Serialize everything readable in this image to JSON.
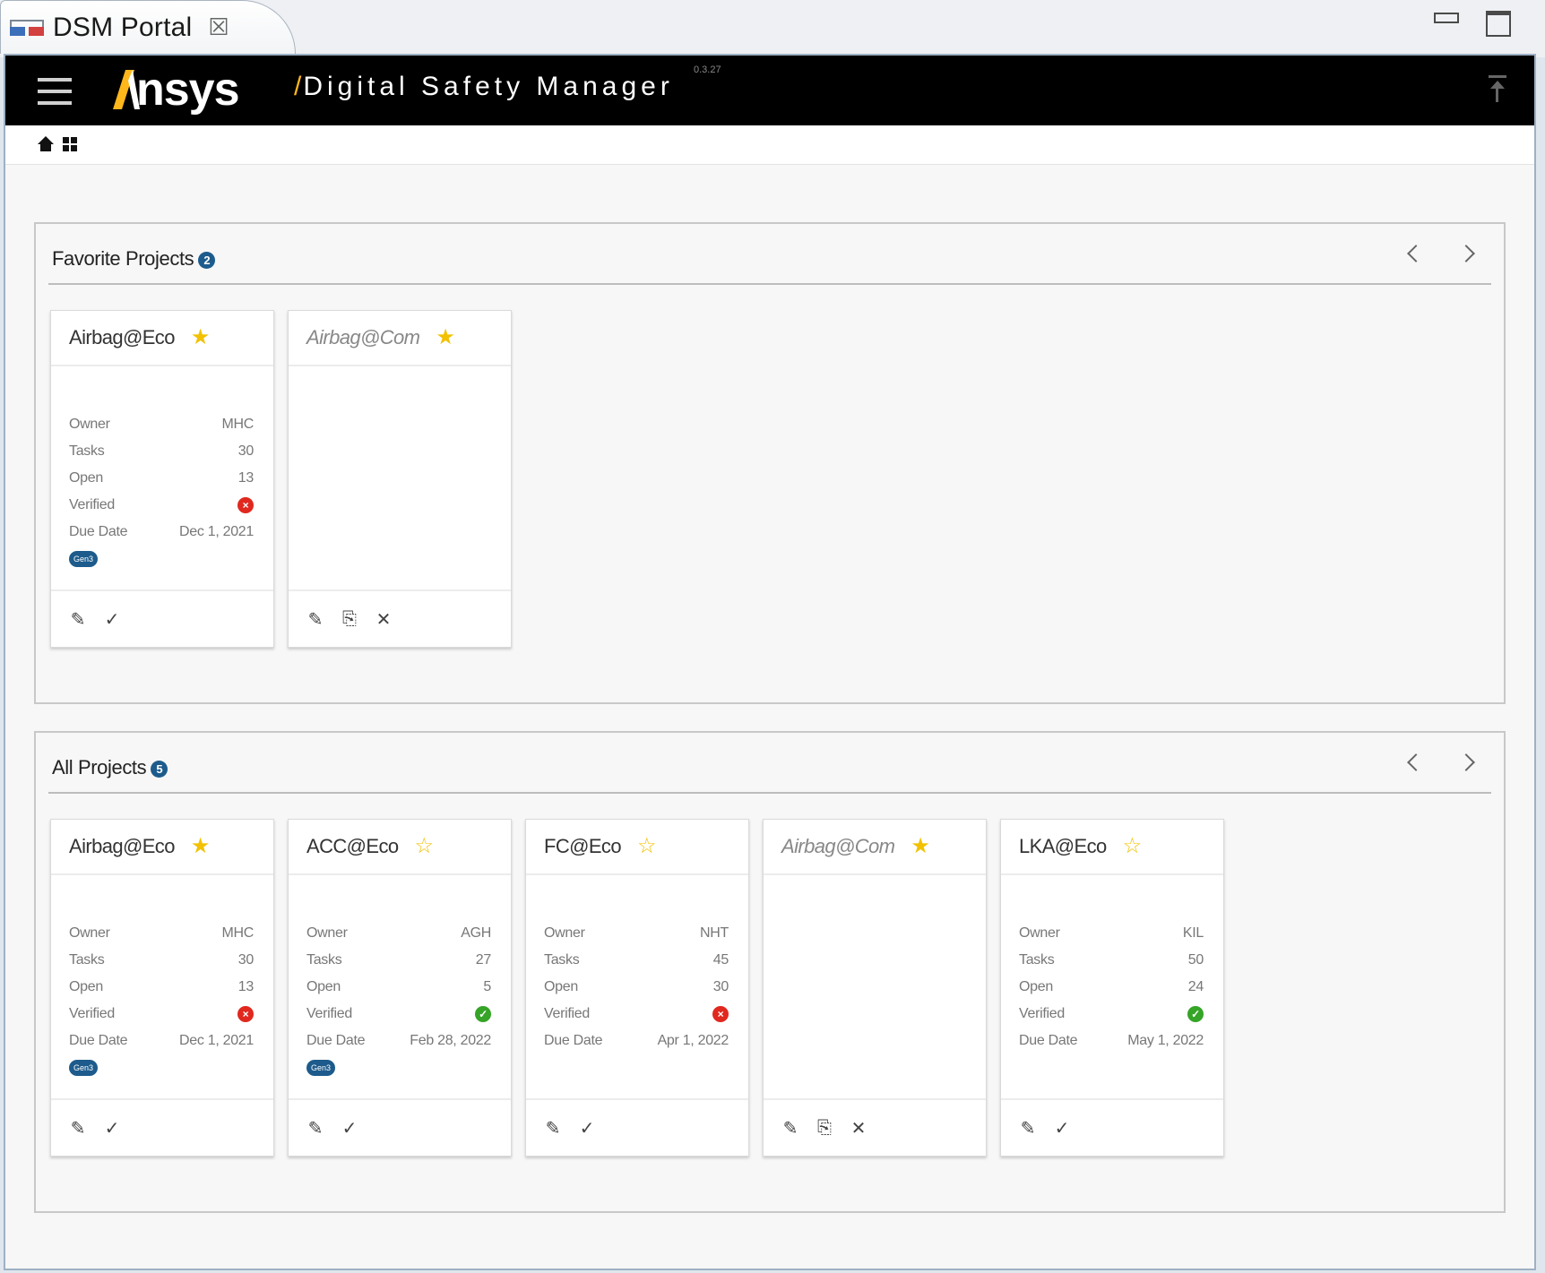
{
  "view_tab": {
    "title": "DSM Portal",
    "close_glyph": "☒"
  },
  "topbar": {
    "logo_text": "nsys",
    "product_slash": "/",
    "product_name": "Digital Safety Manager",
    "version": "0.3.27",
    "colors": {
      "background": "#000000",
      "accent": "#ffb71b"
    }
  },
  "breadcrumb": {
    "home_icon": "home-icon",
    "apps_icon": "apps-grid-icon"
  },
  "labels": {
    "owner": "Owner",
    "tasks": "Tasks",
    "open": "Open",
    "verified": "Verified",
    "due_date": "Due Date"
  },
  "icons": {
    "star_filled": "★",
    "star_empty": "☆",
    "edit": "✎",
    "verify": "✓",
    "import": "⎘",
    "remove": "✕",
    "status_bad": "×",
    "status_good": "✓"
  },
  "favorites": {
    "title": "Favorite Projects",
    "badge": "2",
    "cards": [
      {
        "name": "Airbag@Eco",
        "owner": "MHC",
        "tasks": "30",
        "open": "13",
        "verified": "bad",
        "due": "Dec 1, 2021",
        "tag": "Gen3"
      },
      {
        "name": "Airbag@Com"
      }
    ]
  },
  "all_projects": {
    "title": "All Projects",
    "badge": "5",
    "cards": [
      {
        "name": "Airbag@Eco",
        "owner": "MHC",
        "tasks": "30",
        "open": "13",
        "verified": "bad",
        "due": "Dec 1, 2021",
        "tag": "Gen3"
      },
      {
        "name": "ACC@Eco",
        "owner": "AGH",
        "tasks": "27",
        "open": "5",
        "verified": "good",
        "due": "Feb 28, 2022",
        "tag": "Gen3"
      },
      {
        "name": "FC@Eco",
        "owner": "NHT",
        "tasks": "45",
        "open": "30",
        "verified": "bad",
        "due": "Apr 1, 2022"
      },
      {
        "name": "Airbag@Com"
      },
      {
        "name": "LKA@Eco",
        "owner": "KIL",
        "tasks": "50",
        "open": "24",
        "verified": "good",
        "due": "May 1, 2022"
      }
    ]
  }
}
